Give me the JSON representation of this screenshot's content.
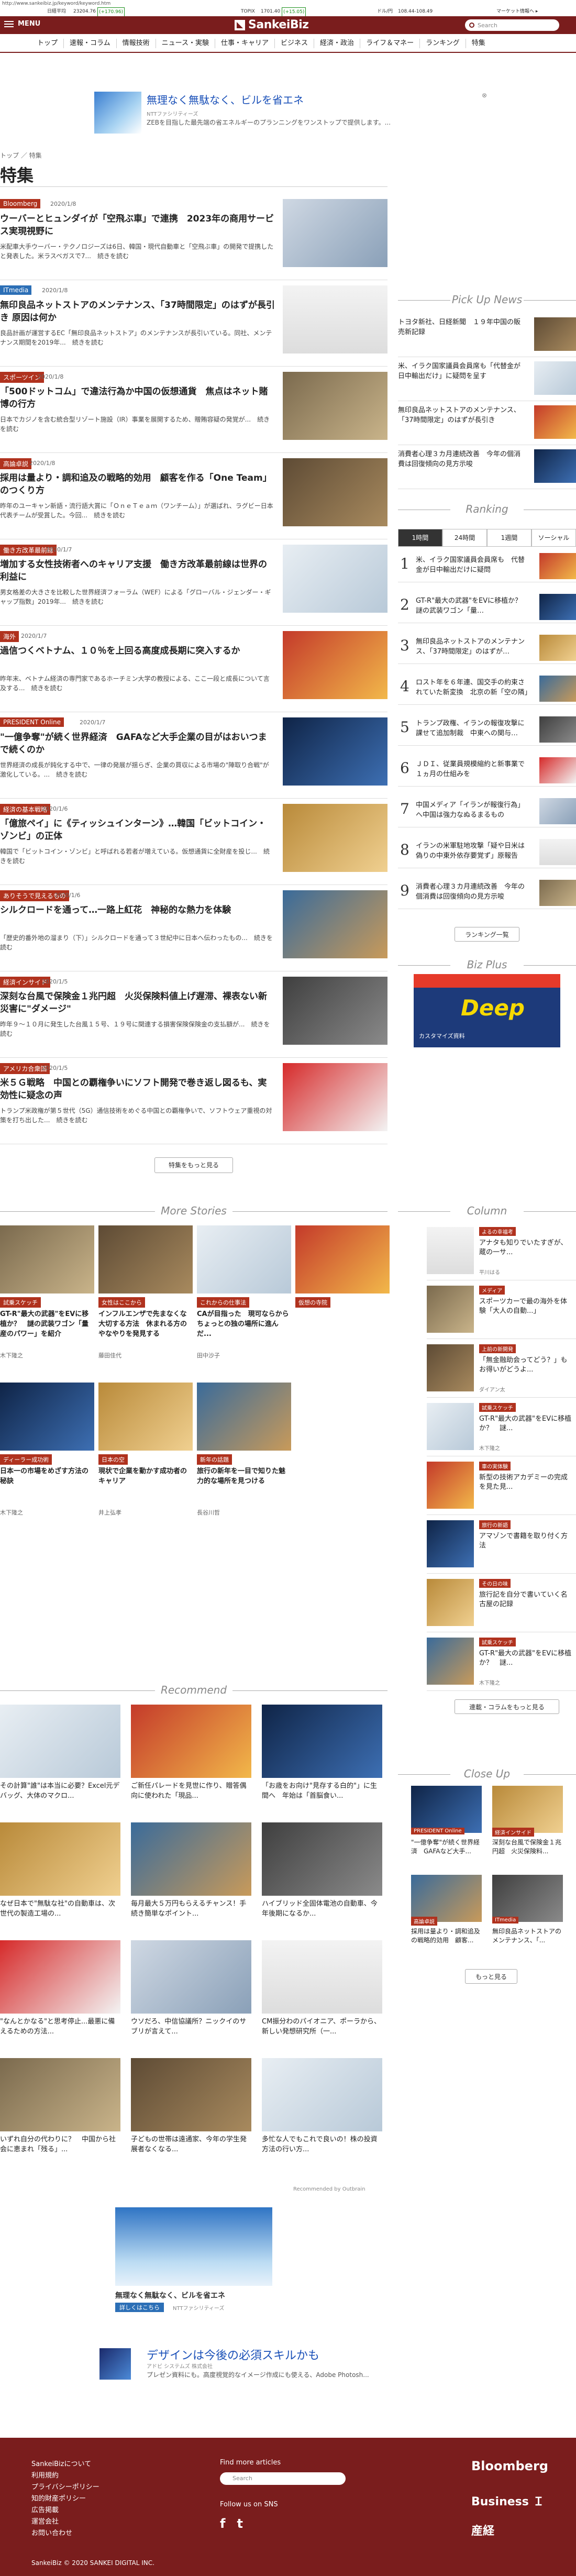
{
  "address_bar": {
    "url": "http://www.sankeibiz.jp/keyword/keyword.htm"
  },
  "ticker": {
    "nikkei_label": "日経平均",
    "nikkei_value": "23204.76",
    "nikkei_change": "(+170.96)",
    "topix_label": "TOPIX",
    "topix_value": "1701.40",
    "topix_change": "(+15.05)",
    "usd_label": "ドル/円",
    "usd_value": "108.44-108.49",
    "market_link": "マーケット情報へ ▸"
  },
  "header": {
    "menu_label": "MENU",
    "logo_text": "SankeiBiz",
    "search_placeholder": "Search"
  },
  "nav": {
    "items": [
      "トップ",
      "速報・コラム",
      "情報技術",
      "ニュース・実験",
      "仕事・キャリア",
      "ビジネス",
      "経済・政治",
      "ライフ＆マネー",
      "ランキング",
      "特集"
    ]
  },
  "ad_top": {
    "title": "無理なく無駄なく、ビルを省エネ",
    "sponsor": "NTTファシリティーズ",
    "desc": "ZEBを目指した最先端の省エネルギーのプランニングをワンストップで提供します。..."
  },
  "breadcrumb": "トップ ／ 特集",
  "page_title": "特集",
  "articles": [
    {
      "cat": "Bloomberg",
      "cat_color": "#b0321e",
      "date": "2020/1/8",
      "title": "ウーバーとヒュンダイが「空飛ぶ車」で連携　2023年の商用サービス実現視野に",
      "desc": "米配車大手ウーバー・テクノロジーズは6日、韓国・現代自動車と「空飛ぶ車」の開発で提携したと発表した。米ラスベガスで7...　続きを読む"
    },
    {
      "cat": "ITmedia",
      "cat_color": "#2c6fb6",
      "date": "2020/1/8",
      "title": "無印良品ネットストアのメンテナンス、「37時間限定」のはずが長引き 原因は何か",
      "desc": "良品計画が運営するEC「無印良品ネットストア」のメンテナンスが長引いている。同社、メンテナンス期間を2019年...　続きを読む"
    },
    {
      "cat": "スポーツイン",
      "cat_color": "#b0321e",
      "date": "2020/1/8",
      "title": "「500ドットコム」で違法行為か中国の仮想通貨　焦点はネット賭博の行方",
      "desc": "日本でカジノを含む統合型リゾート施設（IR）事業を展開するため、贈賄容疑の発覚が...　続きを読む"
    },
    {
      "cat": "高論卓説",
      "cat_color": "#b0321e",
      "date": "2020/1/8",
      "title": "採用は量より・調和追及の戦略的効用　顧客を作る「One Team」のつくり方",
      "desc": "昨年のユーキャン新語・流行語大賞に「ＯｎｅＴｅａｍ（ワンチーム）」が選ばれ、ラグビー日本代表チームが受賞した。今回...　続きを読む"
    },
    {
      "cat": "働き方改革最前線",
      "cat_color": "#b0321e",
      "date": "2020/1/7",
      "title": "増加する女性技術者へのキャリア支援　働き方改革最前線は世界の利益に",
      "desc": "男女格差の大きさを比較した世界経済フォーラム（WEF）による「グローバル・ジェンダー・ギャップ指数」2019年...　続きを読む"
    },
    {
      "cat": "海外",
      "cat_color": "#b0321e",
      "date": "2020/1/7",
      "title": "過信つくベトナム、１０％を上回る高度成長期に突入するか",
      "desc": "昨年末、ベトナム経済の専門家であるホーチミン大学の教授による、ここ一段と成長について言及する...　続きを読む"
    },
    {
      "cat": "PRESIDENT Online",
      "cat_color": "#b0321e",
      "date": "2020/1/7",
      "title": "\"一億争奪\"が続く世界経済　GAFAなど大手企業の目がはおいつまで続くのか",
      "desc": "世界経済の成長が鈍化する中で、一律の発展が揺らぎ、企業の買収による市場の\"陣取り合戦\"が激化している。...　続きを読む"
    },
    {
      "cat": "経済の基本戦略",
      "cat_color": "#b0321e",
      "date": "2020/1/6",
      "title": "「億旅ペイ」に《ティッシュインターン》…韓国「ビットコイン・ゾンビ」の正体",
      "desc": "韓国で「ビットコイン・ゾンビ」と呼ばれる若者が増えている。仮想通貨に全財産を投じ...　続きを読む"
    },
    {
      "cat": "ありそうで見えるもの",
      "cat_color": "#b0321e",
      "date": "2020/1/6",
      "title": "シルクロードを通って…一路上紅花　神秘的な熱力を体験",
      "desc": "「歴史的番外地の溜まり（下）」シルクロードを通って３世紀中に日本へ伝わったもの...　続きを読む"
    },
    {
      "cat": "経済インサイド",
      "cat_color": "#b0321e",
      "date": "2020/1/5",
      "title": "深刻な台風で保険金１兆円超　火災保険料値上げ遅滞、裸表ない新災害に\"ダメージ\"",
      "desc": "昨年９〜１０月に発生した台風１５号、１９号に関連する損害保険保険金の支払額が...　続きを読む"
    },
    {
      "cat": "アメリカ合衆国",
      "cat_color": "#b0321e",
      "date": "2020/1/5",
      "title": "米５Ｇ戦略　中国との覇権争いにソフト開発で巻き返し図るも、実効性に疑念の声",
      "desc": "トランプ米政権が第５世代（5G）通信技術をめぐる中国との覇権争いで、ソフトウェア重視の対策を打ち出した...　続きを読む"
    }
  ],
  "more_button": "特集をもっと見る",
  "pickup": {
    "heading": "Pick Up News",
    "items": [
      "トヨタ新社、日経新聞　１９年中国の販売新記録",
      "米、イラク国家議員会員席も「代替金が日中輸出だけ」に疑問を呈す",
      "無印良品ネットストアのメンテナンス、「37時間限定」のはずが長引き",
      "消費者心理３カ月連続改善　今年の個消費は回復傾向の見方示唆"
    ]
  },
  "ranking": {
    "heading": "Ranking",
    "tabs": [
      "1時間",
      "24時間",
      "1週間",
      "ソーシャル"
    ],
    "items": [
      "米、イラク国家議員会員席も　代替金が日中輸出だけに疑問",
      "GT-R\"最大の武器\"をEVに移植か？　謎の武装ワゴン「量…",
      "無印良品ネットストアのメンテナンス、「37時間限定」のはずが…",
      "ロスト年を６年連、国交手の約束されていた新変換　北京の新「空の隣」",
      "トランプ政権、イランの報復攻撃に課せて追加制裁　中東への関与…",
      "ＪＤＩ、従業員規模縮約と新事業で１ヵ月の仕組みを",
      "中国メディア「イランが報復行為」へ中国は強力なぬるまるもの",
      "イランの米軍駐地攻撃「疑や日米は偽りの中東外依存要覚ず」原報告",
      "消費者心理３カ月連続改善　今年の個消費は回復傾向の見方示唆"
    ],
    "more": "ランキング一覧"
  },
  "bizplus": {
    "heading": "Biz Plus",
    "ad_label": "Deep",
    "ad_sub": "カスタマイズ資料"
  },
  "more_stories": {
    "heading": "More Stories",
    "items": [
      {
        "cat": "試乗スケッチ",
        "title": "GT-R\"最大の武器\"をEVに移植か？　謎の武装ワゴン「量産のパワー」を紹介",
        "src": "木下隆之"
      },
      {
        "cat": "女性はここから",
        "title": "インフルエンザで先まなくな大切する方法　休まれる方のやなやりを発見する",
        "src": "藤田佳代"
      },
      {
        "cat": "これからの仕事法",
        "title": "CAが目指った　現可ならからちょっとの独の場所に進んだ...",
        "src": "田中沙子"
      },
      {
        "cat": "仮想の寺院",
        "title": "",
        "src": ""
      },
      {
        "cat": "ディーラー成功術",
        "title": "日本一の市場をめざす方法の秘訣",
        "src": "木下隆之"
      },
      {
        "cat": "日本の空",
        "title": "現状で企業を動かす成功者のキャリア",
        "src": "井上弘孝"
      },
      {
        "cat": "新年の話題",
        "title": "旅行の新年を一目で知りた魅力的な場所を見つける",
        "src": "長谷川哲"
      }
    ]
  },
  "column": {
    "heading": "Column",
    "items": [
      {
        "cat": "よるの幸福考",
        "title": "アナタも知りでいたすぎが、蔵の一サ...",
        "src": "平川はる"
      },
      {
        "cat": "メディア",
        "title": "スポーツカーで最の海外を体験「大人の自動...」",
        "src": ""
      },
      {
        "cat": "上前の新開発",
        "title": "「無金融助会ってどう？」も　お得いがどうよ...",
        "src": "ダイアン太"
      },
      {
        "cat": "試乗スケッチ",
        "title": "GT-R\"最大の武器\"をEVに移植か？　謎...",
        "src": "木下隆之"
      },
      {
        "cat": "車の実体験",
        "title": "新型の技術アカデミーの完成を見た見...",
        "src": ""
      },
      {
        "cat": "旅行の新語",
        "title": "アマゾンで書籍を取り付く方法",
        "src": ""
      },
      {
        "cat": "その日の味",
        "title": "旅行記を自分で書いていく名古屋の記録",
        "src": ""
      },
      {
        "cat": "試乗スケッチ",
        "title": "GT-R\"最大の武器\"をEVに移植か？　謎...",
        "src": "木下隆之"
      }
    ],
    "more": "連載・コラムをもっと見る"
  },
  "recommend": {
    "heading": "Recommend",
    "items": [
      {
        "title": "その計算\"誰\"は本当に必要？Excel元デバッグ、大体のマクロ...",
        "src": ""
      },
      {
        "title": "ご新任パレードを見世に作り、贈答偶向に使われた「現品...",
        "src": ""
      },
      {
        "title": "「お歳をお向け\"見存する白的\"」に生間へ　年始は「首脳食い...",
        "src": ""
      },
      {
        "title": "なぜ日本で\"無駄な社\"の自動車は、次世代の製造工場の...",
        "src": ""
      },
      {
        "title": "毎月最大５万円もらえるチャンス！手続き簡単なポイント...",
        "src": ""
      },
      {
        "title": "ハイブリッド全固体電池の自動車、今年後期になるか...",
        "src": ""
      },
      {
        "title": "\"なんとかなる\"と思考停止...最悪に備えるための方法...",
        "src": ""
      },
      {
        "title": "ウソだろ、中信協議所？ニックイのサブリが言えて...",
        "src": ""
      },
      {
        "title": "CM振分わのパイオニア、ポーラから、新しい発想研究所（一...",
        "src": ""
      },
      {
        "title": "いずれ自分の代わりに？　中国から社会に恵まれ「残る」...",
        "src": ""
      },
      {
        "title": "子どもの世帯は遠通家、今年の学生発展者なくなる...",
        "src": ""
      },
      {
        "title": "多忙な人でもこれで良いの！株の投資方法の行い方...",
        "src": ""
      }
    ],
    "credit": "Recommended by Outbrain"
  },
  "closeup": {
    "heading": "Close Up",
    "items": [
      {
        "cat": "PRESIDENT Online",
        "title": "\"一億争奪\"が続く世界経済　GAFAなど大手..."
      },
      {
        "cat": "経済インサイド",
        "title": "深刻な台風で保険金１兆円超　火災保険料..."
      },
      {
        "cat": "高論卓説",
        "title": "採用は量より・調和追及の戦略的効用　顧客..."
      },
      {
        "cat": "ITmedia",
        "title": "無印良品ネットストアのメンテナンス、「..."
      }
    ],
    "more": "もっと見る"
  },
  "ad_bottom1": {
    "title": "無理なく無駄なく、ビルを省エネ",
    "sponsor": "NTTファシリティーズ",
    "btn": "詳しくはこちら"
  },
  "ad_bottom2": {
    "title": "デザインは今後の必須スキルかも",
    "sponsor": "アドビ システムズ 株式会社",
    "desc": "プレゼン資料にも。高度視覚的なイメージ作成にも使える、Adobe Photosh..."
  },
  "footer": {
    "links": [
      "SankeiBizについて",
      "利用規約",
      "プライバシーポリシー",
      "知的財産ポリシー",
      "広告掲載",
      "運営会社",
      "お問い合わせ"
    ],
    "find_more": "Find more articles",
    "search_placeholder": "Search",
    "follow": "Follow us on SNS",
    "sns": [
      "f",
      "t"
    ],
    "brand1": "Bloomberg",
    "brand2": "Business Ｉ",
    "brand3": "産経",
    "copyright": "SankeiBiz © 2020 SANKEI DIGITAL INC."
  },
  "colors": {
    "brand": "#7a1d1d",
    "category_red": "#b0321e",
    "category_blue": "#2c6fb6"
  }
}
